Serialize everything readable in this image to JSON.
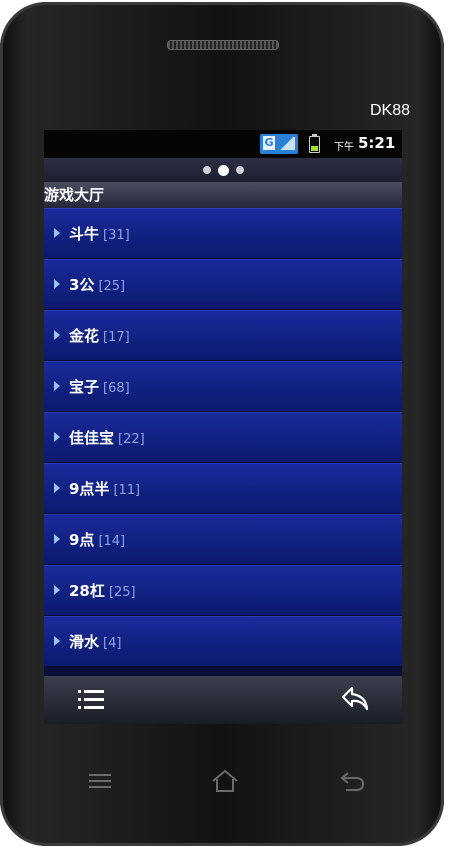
{
  "device": {
    "brand": "DK88"
  },
  "statusbar": {
    "network": "G",
    "ampm": "下午",
    "time": "5:21"
  },
  "page": {
    "title": "游戏大厅",
    "pages": 3,
    "active_page": 2
  },
  "list": {
    "items": [
      {
        "label": "斗牛",
        "count": "[31]"
      },
      {
        "label": "3公",
        "count": "[25]"
      },
      {
        "label": "金花",
        "count": "[17]"
      },
      {
        "label": "宝子",
        "count": "[68]"
      },
      {
        "label": "佳佳宝",
        "count": "[22]"
      },
      {
        "label": "9点半",
        "count": "[11]"
      },
      {
        "label": "9点",
        "count": "[14]"
      },
      {
        "label": "28杠",
        "count": "[25]"
      },
      {
        "label": "滑水",
        "count": "[4]"
      }
    ]
  },
  "toolbar": {
    "menu_icon": "list-icon",
    "back_icon": "back-arrow-icon"
  },
  "hardware_keys": [
    "menu-key-icon",
    "home-key-icon",
    "back-key-icon"
  ],
  "colors": {
    "row_bg": "#1b2a9c",
    "count_text": "#8fa3e6",
    "signal_badge": "#2a7fd6"
  }
}
